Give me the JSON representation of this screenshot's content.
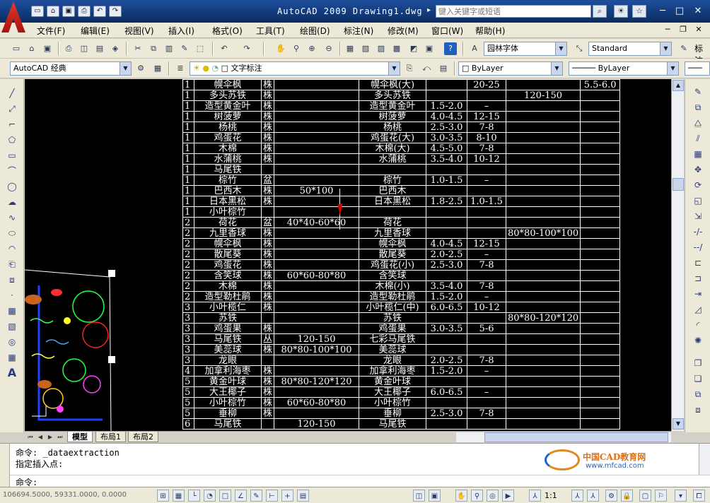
{
  "window": {
    "title": "AutoCAD 2009 Drawing1.dwg",
    "search_placeholder": "键入关键字或短语",
    "controls": [
      "─",
      "□",
      "✕"
    ]
  },
  "menu": [
    "文件(F)",
    "编辑(E)",
    "视图(V)",
    "插入(I)",
    "格式(O)",
    "工具(T)",
    "绘图(D)",
    "标注(N)",
    "修改(M)",
    "窗口(W)",
    "帮助(H)"
  ],
  "toolbar1": {
    "text_style": "园林字体",
    "dim_style": "Standard",
    "last_label": "标注"
  },
  "toolbar2": {
    "workspace": "AutoCAD 经典",
    "layer": "文字标注",
    "color": "ByLayer",
    "linetype": "ByLayer"
  },
  "table_rows": [
    [
      "1",
      "幌伞枫",
      "株",
      "",
      "幌伞枫(大)",
      "",
      "20-25",
      "",
      "5.5-6.0"
    ],
    [
      "1",
      "多头苏铁",
      "株",
      "",
      "多头苏铁",
      "",
      "",
      "120-150",
      ""
    ],
    [
      "1",
      "造型黄金叶",
      "株",
      "",
      "造型黄金叶",
      "1.5-2.0",
      "–",
      "",
      ""
    ],
    [
      "1",
      "树菠萝",
      "株",
      "",
      "树菠萝",
      "4.0-4.5",
      "12-15",
      "",
      ""
    ],
    [
      "1",
      "杨桃",
      "株",
      "",
      "杨桃",
      "2.5-3.0",
      "7-8",
      "",
      ""
    ],
    [
      "1",
      "鸡蛋花",
      "株",
      "",
      "鸡蛋花(大)",
      "3.0-3.5",
      "8-10",
      "",
      ""
    ],
    [
      "1",
      "木棉",
      "株",
      "",
      "木棉(大)",
      "4.5-5.0",
      "7-8",
      "",
      ""
    ],
    [
      "1",
      "水蒲桃",
      "株",
      "",
      "水蒲桃",
      "3.5-4.0",
      "10-12",
      "",
      ""
    ],
    [
      "1",
      "马尾铁",
      "",
      "",
      "",
      "",
      "",
      "",
      ""
    ],
    [
      "1",
      "棕竹",
      "盆",
      "",
      "棕竹",
      "1.0-1.5",
      "–",
      "",
      ""
    ],
    [
      "1",
      "巴西木",
      "株",
      "50*100",
      "巴西木",
      "",
      "",
      "",
      ""
    ],
    [
      "1",
      "日本黑松",
      "株",
      "",
      "日本黑松",
      "1.8-2.5",
      "1.0-1.5",
      "",
      ""
    ],
    [
      "1",
      "小叶棕竹",
      "",
      "",
      "",
      "",
      "",
      "",
      ""
    ],
    [
      "2",
      "荷花",
      "盆",
      "40*40-60*60",
      "荷花",
      "",
      "",
      "",
      ""
    ],
    [
      "2",
      "九里香球",
      "株",
      "",
      "九里香球",
      "",
      "",
      "80*80-100*100",
      ""
    ],
    [
      "2",
      "幌伞枫",
      "株",
      "",
      "幌伞枫",
      "4.0-4.5",
      "12-15",
      "",
      ""
    ],
    [
      "2",
      "散尾葵",
      "株",
      "",
      "散尾葵",
      "2.0-2.5",
      "–",
      "",
      ""
    ],
    [
      "2",
      "鸡蛋花",
      "株",
      "",
      "鸡蛋花(小)",
      "2.5-3.0",
      "7-8",
      "",
      ""
    ],
    [
      "2",
      "含笑球",
      "株",
      "60*60-80*80",
      "含笑球",
      "",
      "",
      "",
      ""
    ],
    [
      "2",
      "木棉",
      "株",
      "",
      "木棉(小)",
      "3.5-4.0",
      "7-8",
      "",
      ""
    ],
    [
      "2",
      "造型勒杜鹃",
      "株",
      "",
      "造型勒杜鹃",
      "1.5-2.0",
      "–",
      "",
      ""
    ],
    [
      "3",
      "小叶榄仁",
      "株",
      "",
      "小叶榄仁(中)",
      "6.0-6.5",
      "10-12",
      "",
      ""
    ],
    [
      "3",
      "苏铁",
      "",
      "",
      "苏铁",
      "",
      "",
      "80*80-120*120",
      ""
    ],
    [
      "3",
      "鸡蛋果",
      "株",
      "",
      "鸡蛋果",
      "3.0-3.5",
      "5-6",
      "",
      ""
    ],
    [
      "3",
      "马尾铁",
      "丛",
      "120-150",
      "七彩马尾铁",
      "",
      "",
      "",
      ""
    ],
    [
      "3",
      "美蕊球",
      "株",
      "80*80-100*100",
      "美蕊球",
      "",
      "",
      "",
      ""
    ],
    [
      "3",
      "龙眼",
      "",
      "",
      "龙眼",
      "2.0-2.5",
      "7-8",
      "",
      ""
    ],
    [
      "4",
      "加拿利海枣",
      "株",
      "",
      "加拿利海枣",
      "1.5-2.0",
      "–",
      "",
      ""
    ],
    [
      "5",
      "黄金叶球",
      "株",
      "80*80-120*120",
      "黄金叶球",
      "",
      "",
      "",
      ""
    ],
    [
      "5",
      "大王椰子",
      "株",
      "",
      "大王椰子",
      "6.0-6.5",
      "–",
      "",
      ""
    ],
    [
      "5",
      "小叶棕竹",
      "株",
      "60*60-80*80",
      "小叶棕竹",
      "",
      "",
      "",
      ""
    ],
    [
      "5",
      "垂柳",
      "株",
      "",
      "垂柳",
      "2.5-3.0",
      "7-8",
      "",
      ""
    ],
    [
      "6",
      "马尾铁",
      "",
      "120-150",
      "马尾铁",
      "",
      "",
      "",
      ""
    ]
  ],
  "tabs": [
    "模型",
    "布局1",
    "布局2"
  ],
  "command": {
    "line1": "命令: _dataextraction",
    "line2": "指定插入点:",
    "prompt": "命令:"
  },
  "watermark": {
    "line1": "中国CAD教育网",
    "line2": "www.mfcad.com"
  },
  "status": {
    "coords": "106694.5000, 59331.0000, 0.0000",
    "scale": "1:1"
  }
}
